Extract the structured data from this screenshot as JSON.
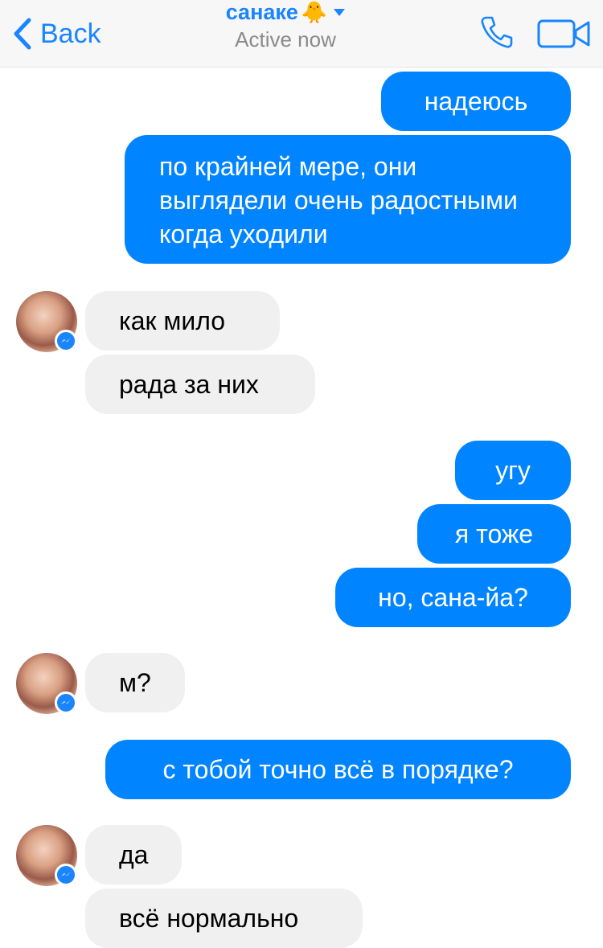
{
  "header": {
    "back_label": "Back",
    "contact_name": "санаке",
    "contact_emoji": "🐥",
    "status": "Active now"
  },
  "messages": [
    {
      "from": "me",
      "text": "надеюсь"
    },
    {
      "from": "me",
      "text": "по крайней мере, они выглядели очень радостными когда уходили"
    },
    {
      "from": "them",
      "text": "как мило"
    },
    {
      "from": "them",
      "text": "рада за них"
    },
    {
      "from": "me",
      "text": "угу"
    },
    {
      "from": "me",
      "text": "я тоже"
    },
    {
      "from": "me",
      "text": "но, сана-йа?"
    },
    {
      "from": "them",
      "text": "м?"
    },
    {
      "from": "me",
      "text": "с тобой точно всё в порядке?"
    },
    {
      "from": "them",
      "text": "да"
    },
    {
      "from": "them",
      "text": "всё нормально"
    }
  ],
  "colors": {
    "accent": "#1a85ff",
    "outgoing_bubble": "#0084ff",
    "incoming_bubble": "#f0f0f0"
  }
}
